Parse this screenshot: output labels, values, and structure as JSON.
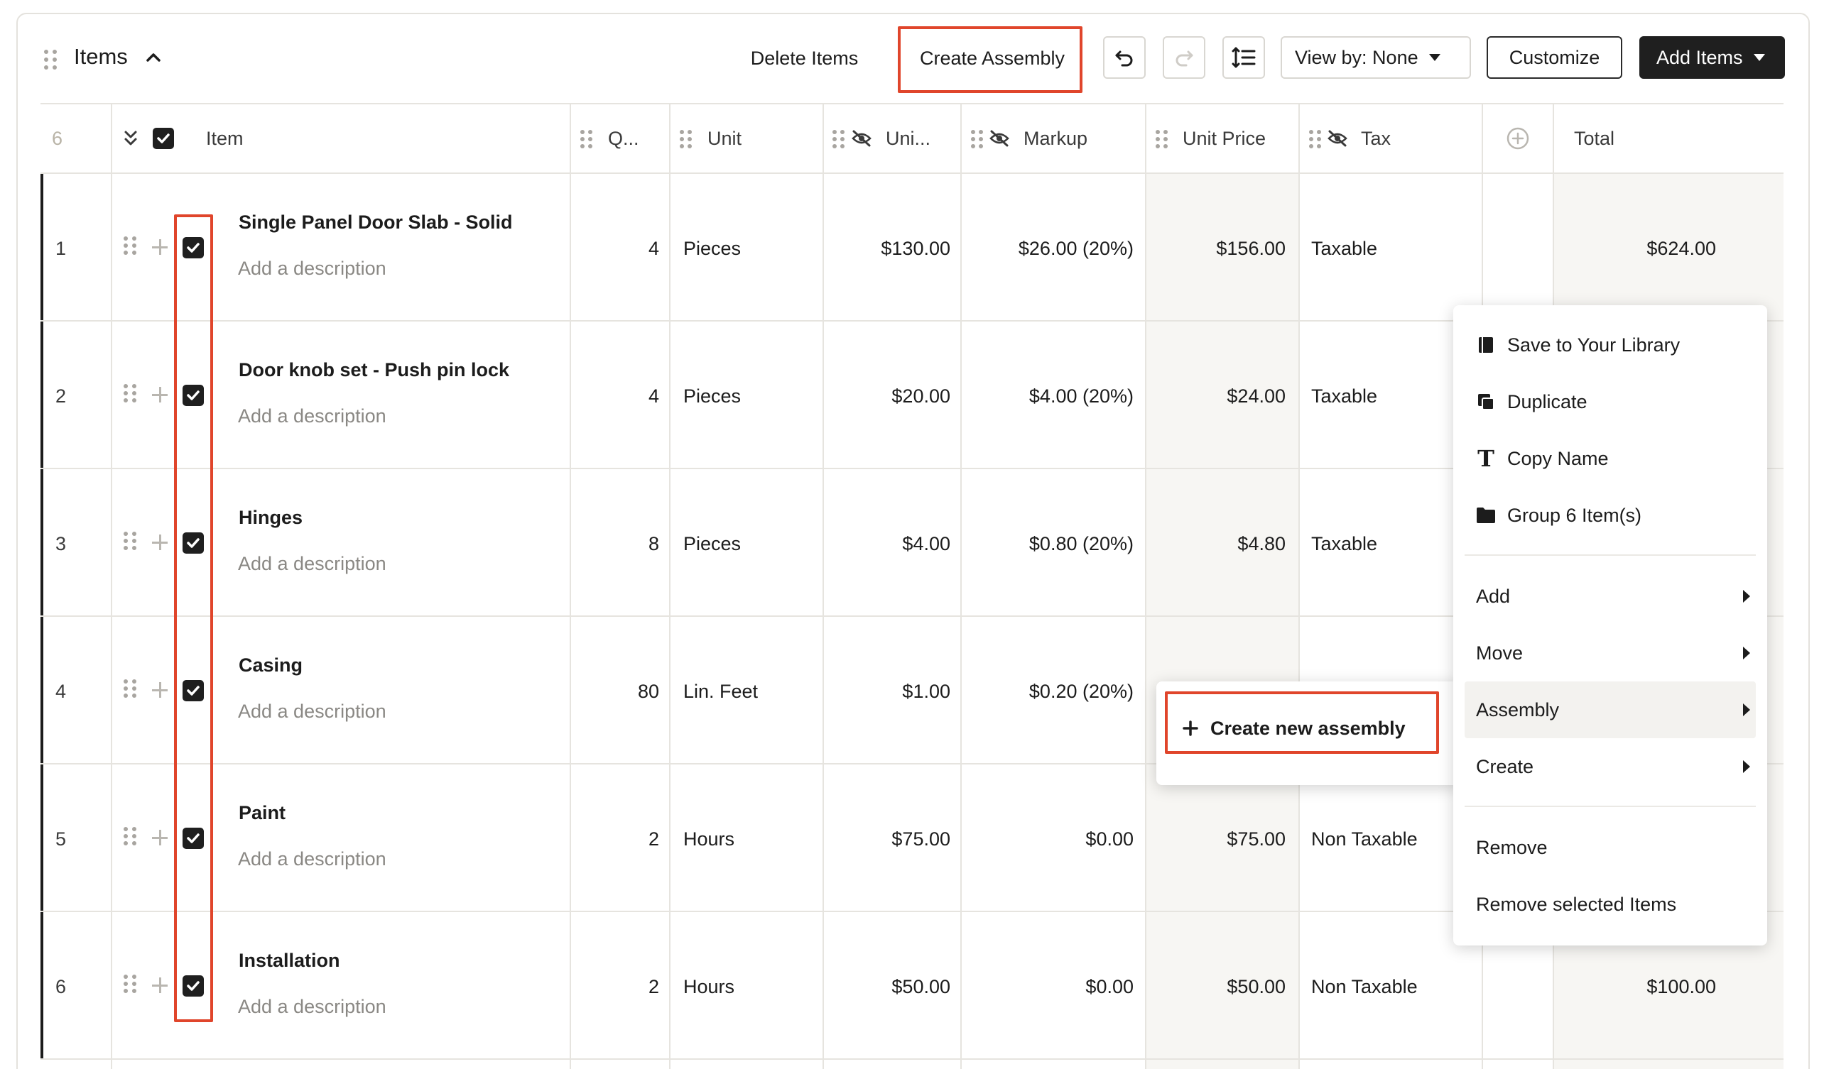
{
  "header": {
    "title": "Items",
    "delete_label": "Delete Items",
    "create_assembly_label": "Create Assembly",
    "view_by_label": "View by: None",
    "customize_label": "Customize",
    "add_items_label": "Add Items"
  },
  "table": {
    "count": "6",
    "columns": {
      "item": "Item",
      "qty": "Q...",
      "unit": "Unit",
      "unit_cost": "Uni...",
      "markup": "Markup",
      "unit_price": "Unit Price",
      "tax": "Tax",
      "total": "Total"
    },
    "rows": [
      {
        "index": "1",
        "name": "Single Panel Door Slab - Solid",
        "desc": "Add a description",
        "qty": "4",
        "unit": "Pieces",
        "unit_cost": "$130.00",
        "markup": "$26.00 (20%)",
        "unit_price": "$156.00",
        "tax": "Taxable",
        "total": "$624.00"
      },
      {
        "index": "2",
        "name": "Door knob set - Push pin lock",
        "desc": "Add a description",
        "qty": "4",
        "unit": "Pieces",
        "unit_cost": "$20.00",
        "markup": "$4.00 (20%)",
        "unit_price": "$24.00",
        "tax": "Taxable",
        "total": ""
      },
      {
        "index": "3",
        "name": "Hinges",
        "desc": "Add a description",
        "qty": "8",
        "unit": "Pieces",
        "unit_cost": "$4.00",
        "markup": "$0.80 (20%)",
        "unit_price": "$4.80",
        "tax": "Taxable",
        "total": ""
      },
      {
        "index": "4",
        "name": "Casing",
        "desc": "Add a description",
        "qty": "80",
        "unit": "Lin. Feet",
        "unit_cost": "$1.00",
        "markup": "$0.20 (20%)",
        "unit_price": "",
        "tax": "",
        "total": ""
      },
      {
        "index": "5",
        "name": "Paint",
        "desc": "Add a description",
        "qty": "2",
        "unit": "Hours",
        "unit_cost": "$75.00",
        "markup": "$0.00",
        "unit_price": "$75.00",
        "tax": "Non Taxable",
        "total": ""
      },
      {
        "index": "6",
        "name": "Installation",
        "desc": "Add a description",
        "qty": "2",
        "unit": "Hours",
        "unit_cost": "$50.00",
        "markup": "$0.00",
        "unit_price": "$50.00",
        "tax": "Non Taxable",
        "total": "$100.00"
      }
    ]
  },
  "context_menu": {
    "save_library": "Save to Your Library",
    "duplicate": "Duplicate",
    "copy_name": "Copy Name",
    "group": "Group 6 Item(s)",
    "add": "Add",
    "move": "Move",
    "assembly": "Assembly",
    "create": "Create",
    "remove": "Remove",
    "remove_selected": "Remove selected Items"
  },
  "submenu": {
    "create_new_assembly": "Create new assembly"
  },
  "colors": {
    "highlight": "#e0452b",
    "dark_button": "#1f1f1f",
    "column_shade": "#f7f6f3"
  }
}
